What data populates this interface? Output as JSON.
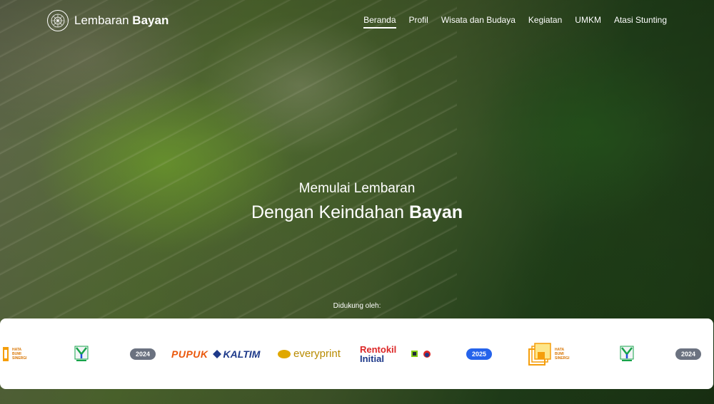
{
  "brand": {
    "name_light": "Lembaran",
    "name_bold": "Bayan",
    "logo_icon": "mandala-logo-icon"
  },
  "nav": {
    "items": [
      {
        "label": "Beranda",
        "active": true
      },
      {
        "label": "Profil",
        "active": false
      },
      {
        "label": "Wisata dan Budaya",
        "active": false
      },
      {
        "label": "Kegiatan",
        "active": false
      },
      {
        "label": "UMKM",
        "active": false
      },
      {
        "label": "Atasi Stunting",
        "active": false
      }
    ]
  },
  "hero": {
    "line1": "Memulai Lembaran",
    "line2_light": "Dengan Keindahan",
    "line2_bold": "Bayan"
  },
  "sponsors": {
    "label": "Didukung oleh:",
    "hata_1": {
      "l1": "HATA",
      "l2": "BUMI",
      "l3": "SINERGI"
    },
    "kkn_logo_1": "kkn-emblem-icon",
    "year_a": "2024",
    "pupuk": "PUPUK",
    "kaltim": "KALTIM",
    "everyprint": "everyprint",
    "rentokil_1": "Rentokil",
    "rentokil_2": "Initial",
    "year_b": "2025",
    "hata_2": {
      "l1": "HATA",
      "l2": "BUMI",
      "l3": "SINERGI"
    },
    "kkn_logo_2": "kkn-emblem-icon",
    "year_c": "2024"
  },
  "colors": {
    "active_pill": "#2563eb",
    "pill": "#6b7280",
    "pupuk": "#ea580c",
    "kaltim": "#1e3a8a",
    "rentokil": "#dc2626"
  }
}
